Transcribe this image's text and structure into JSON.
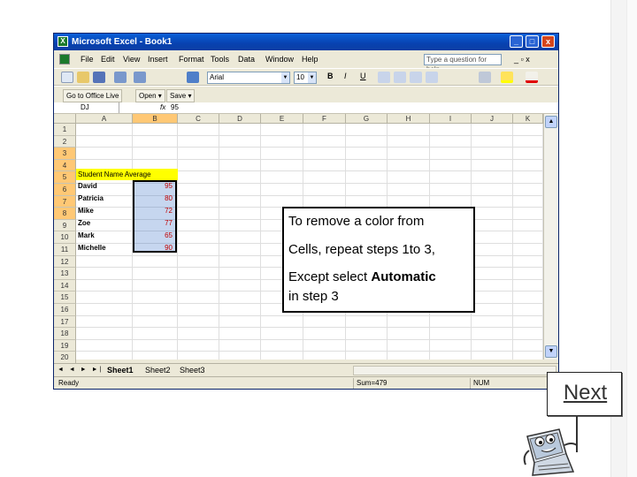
{
  "window": {
    "title": "Microsoft Excel - Book1",
    "controls": [
      "_",
      "□",
      "x"
    ]
  },
  "menu": {
    "items": [
      "File",
      "Edit",
      "View",
      "Insert",
      "Format",
      "Tools",
      "Data",
      "Window",
      "Help"
    ],
    "help_placeholder": "Type a question for help",
    "doc_controls": "_ ▫ x"
  },
  "formatting_toolbar": {
    "font": "Arial",
    "size": "10",
    "bold": "B",
    "italic": "I",
    "underline": "U"
  },
  "office_toolbar": {
    "go_to_office_live": "Go to Office Live",
    "open": "Open ▾",
    "save": "Save ▾"
  },
  "formula_bar": {
    "name_box": "DJ",
    "fx": "fx",
    "value": "95"
  },
  "columns": [
    "A",
    "B",
    "C",
    "D",
    "E",
    "F",
    "G",
    "H",
    "I",
    "J",
    "K"
  ],
  "selected_column": "B",
  "rows": [
    "1",
    "2",
    "3",
    "4",
    "5",
    "6",
    "7",
    "8",
    "9",
    "10",
    "11",
    "12",
    "13",
    "14",
    "15",
    "16",
    "17",
    "18",
    "19",
    "20"
  ],
  "sheet": {
    "header_cell": "Student Name Average",
    "students": [
      {
        "name": "David",
        "score": "95"
      },
      {
        "name": "Patricia",
        "score": "80"
      },
      {
        "name": "Mike",
        "score": "72"
      },
      {
        "name": "Zoe",
        "score": "77"
      },
      {
        "name": "Mark",
        "score": "65"
      },
      {
        "name": "Michelle",
        "score": "90"
      }
    ]
  },
  "sheet_tabs": {
    "nav": "◄ ◄ ► ►|",
    "tabs": [
      "Sheet1",
      "Sheet2",
      "Sheet3"
    ],
    "active": "Sheet1"
  },
  "status": {
    "ready": "Ready",
    "sum": "Sum=479",
    "num": "NUM"
  },
  "callout": {
    "line1": "To remove a color from",
    "line2": "Cells, repeat steps 1to 3,",
    "line3_prefix": "Except select ",
    "line3_bold": "Automatic",
    "line4": "in step 3"
  },
  "next_button": {
    "label": "Next"
  },
  "colors": {
    "title_blue": "#0a5fd8",
    "selection": "#316ac5",
    "highlight_yellow": "#ffff00",
    "score_red": "#c00000"
  },
  "icons": [
    "excel-app-icon",
    "new-icon",
    "open-icon",
    "save-icon",
    "print-icon",
    "undo-icon",
    "redo-icon",
    "chart-icon",
    "fill-color-icon",
    "font-color-icon",
    "mascot-icon"
  ]
}
